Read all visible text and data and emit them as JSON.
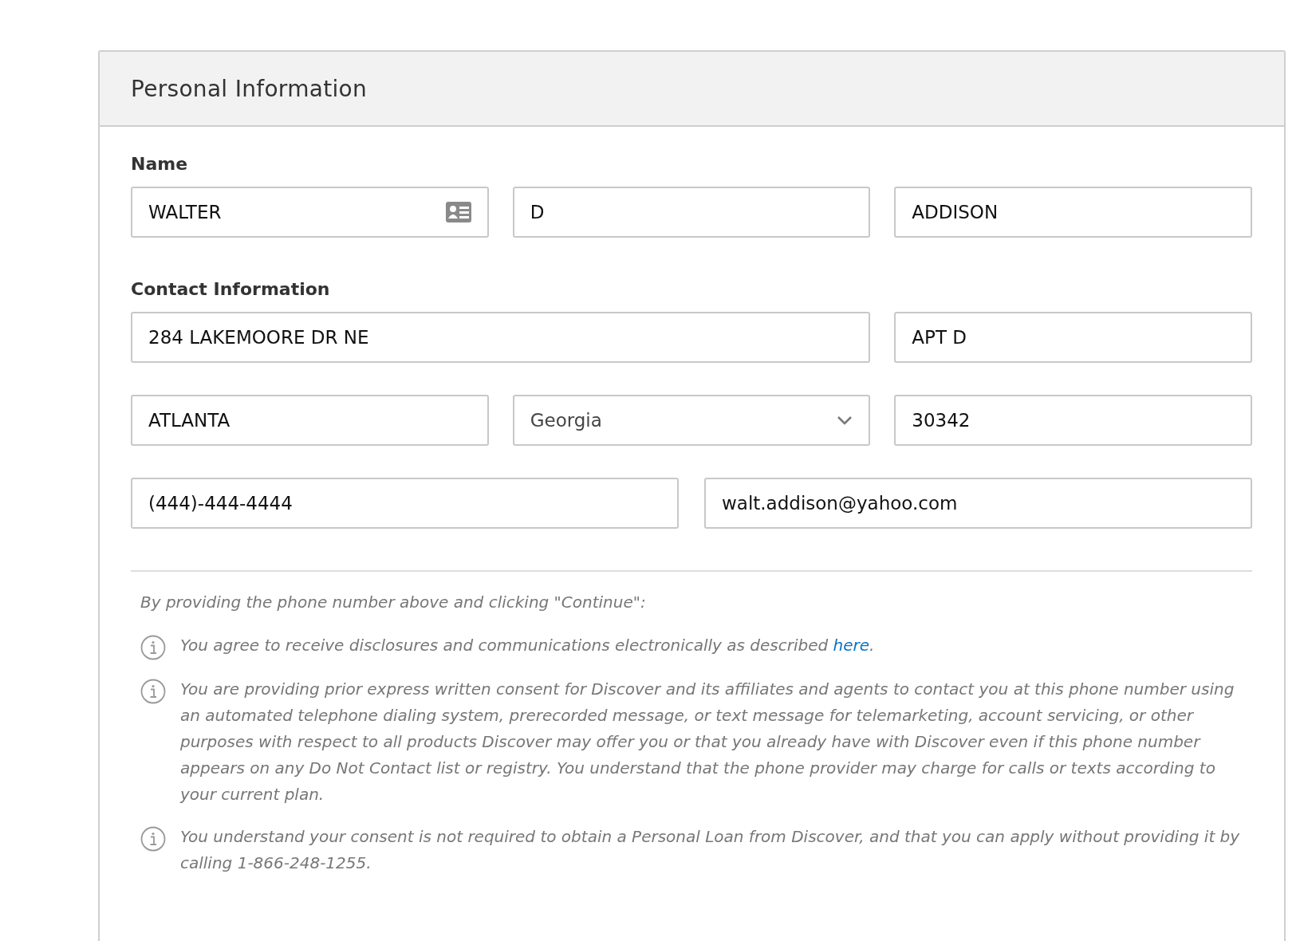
{
  "card": {
    "title": "Personal Information"
  },
  "name_section": {
    "label": "Name",
    "rows": [
      [
        {
          "kind": "first_name",
          "value": "WALTER"
        },
        {
          "kind": "text",
          "value": "D"
        },
        {
          "kind": "text",
          "value": "ADDISON"
        }
      ]
    ]
  },
  "contact_section": {
    "label": "Contact Information",
    "rows": [
      [
        {
          "kind": "street",
          "value": "284 LAKEMOORE DR NE"
        },
        {
          "kind": "text",
          "value": "APT D"
        }
      ],
      [
        {
          "kind": "text",
          "value": "ATLANTA"
        },
        {
          "kind": "select",
          "value": "Georgia"
        },
        {
          "kind": "text",
          "value": "30342"
        }
      ],
      [
        {
          "kind": "text",
          "value": "(444)-444-4444"
        },
        {
          "kind": "text",
          "value": "walt.addison@yahoo.com"
        }
      ]
    ]
  },
  "disclosures": {
    "intro": "By providing the phone number above and clicking \"Continue\":",
    "items": [
      {
        "text": "You agree to receive disclosures and communications electronically as described ",
        "link": "here",
        "after": "."
      },
      {
        "text": "You are providing prior express written consent for Discover and its affiliates and agents to contact you at this phone number using an automated telephone dialing system, prerecorded message, or text message for telemarketing, account servicing, or other purposes with respect to all products Discover may offer you or that you already have with Discover even if this phone number appears on any Do Not Contact list or registry. You understand that the phone provider may charge for calls or texts according to your current plan."
      },
      {
        "text": "You understand your consent is not required to obtain a Personal Loan from Discover, and that you can apply without providing it by calling 1-866-248-1255."
      }
    ]
  }
}
